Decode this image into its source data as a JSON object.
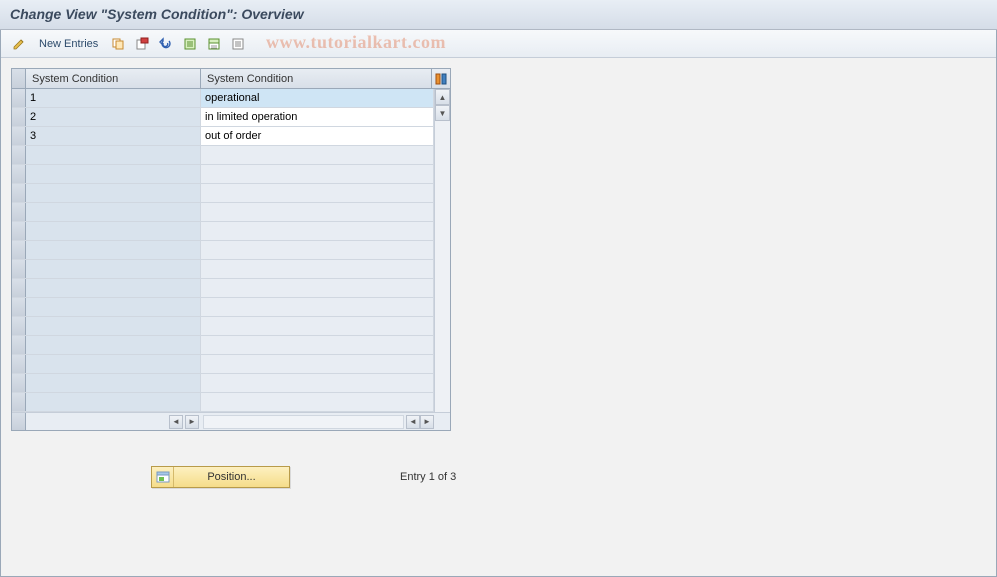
{
  "title": "Change View \"System Condition\": Overview",
  "toolbar": {
    "new_entries_label": "New Entries"
  },
  "watermark": "www.tutorialkart.com",
  "grid": {
    "columns": [
      "System Condition",
      "System Condition"
    ],
    "rows": [
      {
        "code": "1",
        "desc": "operational",
        "highlighted": true
      },
      {
        "code": "2",
        "desc": "in limited operation",
        "highlighted": false
      },
      {
        "code": "3",
        "desc": "out of order",
        "highlighted": false
      }
    ],
    "empty_rows": 14
  },
  "footer": {
    "position_label": "Position...",
    "entry_text": "Entry 1 of 3"
  }
}
